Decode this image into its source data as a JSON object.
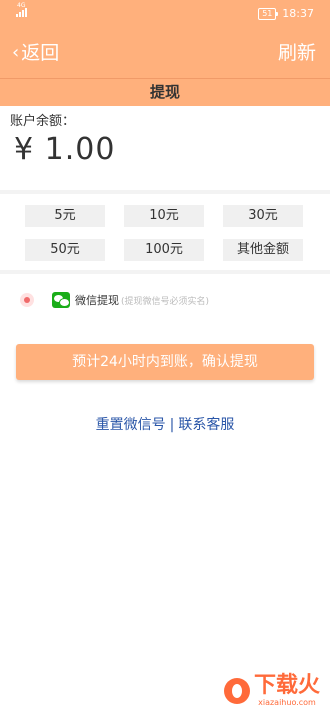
{
  "status_bar": {
    "network": "4G",
    "battery": "51",
    "time": "18:37"
  },
  "app_bar": {
    "back_label": "返回",
    "refresh_label": "刷新"
  },
  "page": {
    "title": "提现",
    "balance_label": "账户余额：",
    "balance_value": "¥ 1.00"
  },
  "amount_options": [
    "5元",
    "10元",
    "30元",
    "50元",
    "100元",
    "其他金额"
  ],
  "withdraw_method": {
    "name": "微信提现",
    "note": "(提现微信号必须实名)"
  },
  "confirm_button": "预计24小时内到账，确认提现",
  "links": {
    "reset_wechat": "重置微信号",
    "separator": "|",
    "contact_service": "联系客服"
  },
  "watermark": {
    "main": "下载火",
    "sub": "xiazaihuo.com"
  },
  "colors": {
    "accent": "#ffb07c",
    "link": "#2a56a8",
    "wechat": "#1aad19"
  }
}
